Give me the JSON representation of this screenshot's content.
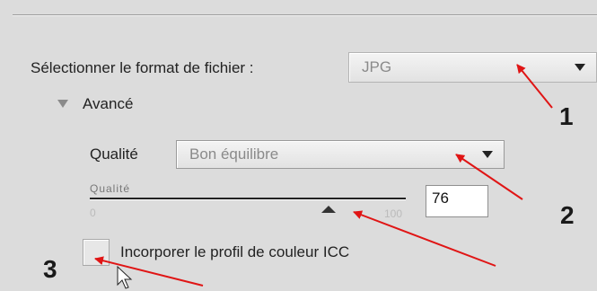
{
  "format": {
    "label": "Sélectionner le format de fichier :",
    "value": "JPG"
  },
  "advanced": {
    "label": "Avancé"
  },
  "quality": {
    "label": "Qualité",
    "preset_value": "Bon équilibre",
    "slider_label": "Qualité",
    "slider_min": "0",
    "slider_max": "100",
    "value": "76",
    "slider_value": 76
  },
  "icc": {
    "label": "Incorporer le profil de couleur ICC",
    "checked": false
  },
  "callouts": [
    "1",
    "2",
    "3"
  ],
  "colors": {
    "arrow": "#e01515",
    "background": "#dcdcdc"
  }
}
